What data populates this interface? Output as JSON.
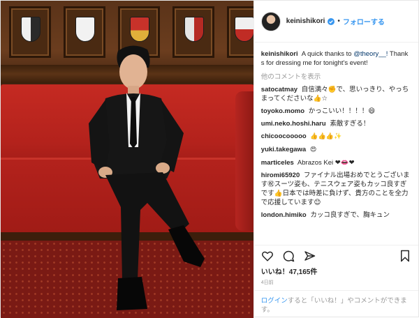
{
  "header": {
    "username": "keinishikori",
    "follow_label": "フォローする"
  },
  "caption": {
    "username": "keinishikori",
    "text_before": "A quick thanks to",
    "mention": "@theory__!",
    "text_after": "Thanks for dressing me for tonight's event!"
  },
  "more_comments_label": "他のコメントを表示",
  "comments": [
    {
      "user": "satocatmay",
      "text": "自信満々✊で、思いっきり、やっちまってくださいな👍☆"
    },
    {
      "user": "toyoko.momo",
      "text": "かっこいい！！！！😄"
    },
    {
      "user": "umi.neko.hoshi.haru",
      "text": "素敵すぎる！"
    },
    {
      "user": "chicoocooooo",
      "text": "👍👍👍✨"
    },
    {
      "user": "yuki.takegawa",
      "text": "😍"
    },
    {
      "user": "marticeles",
      "text": "Abrazos Kei ❤👄❤"
    },
    {
      "user": "hiromi65920",
      "text": "ファイナル出場おめでとうございます㊗スーツ姿も、テニスウェア姿もカッコ良すぎです👍日本では時差に負けず、貴方のことを全力で応援しています😊"
    },
    {
      "user": "london.himiko",
      "text": "カッコ良すぎで、胸キュン"
    }
  ],
  "likes": {
    "label": "いいね！",
    "count": "47,165件"
  },
  "date": "4日前",
  "login": {
    "link_text": "ログイン",
    "text": "すると「いいね！」やコメントができます。"
  },
  "icons": {
    "like": "heart-icon",
    "comment": "comment-icon",
    "share": "share-icon",
    "save": "bookmark-icon",
    "verified": "verified-badge-icon"
  },
  "colors": {
    "link_blue": "#3897f0",
    "mention_blue": "#003569",
    "muted_gray": "#999999",
    "text": "#262626"
  }
}
